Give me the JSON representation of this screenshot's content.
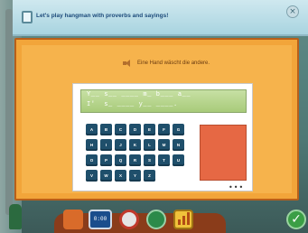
{
  "header": {
    "title": "Let's play hangman with proverbs and sayings!"
  },
  "prompt": {
    "text": "Eine Hand wäscht die andere."
  },
  "puzzle": {
    "line1": "Y__ s__ ____ m_ b___ a__",
    "line2": "I'  s_ ____ y__ ____."
  },
  "keyboard": {
    "keys": [
      "A",
      "B",
      "C",
      "D",
      "E",
      "F",
      "G",
      "H",
      "I",
      "J",
      "K",
      "L",
      "M",
      "N",
      "O",
      "P",
      "Q",
      "R",
      "S",
      "T",
      "U",
      "V",
      "W",
      "X",
      "Y",
      "Z"
    ]
  },
  "toolbar": {
    "display_text": "0:00"
  },
  "icons": {
    "close": "close-icon",
    "speaker": "speaker-icon",
    "check": "check-icon"
  },
  "colors": {
    "board": "#f2a53a",
    "key": "#1f4f6b",
    "hangman": "#e66844",
    "puzzle": "#b0d183"
  }
}
